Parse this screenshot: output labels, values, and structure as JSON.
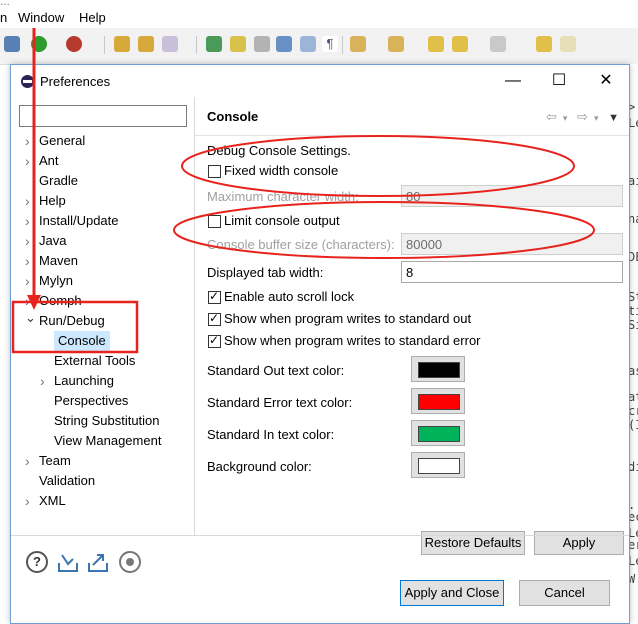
{
  "background_window": {
    "title_fragment": "...",
    "menu": [
      "n",
      "Window",
      "Help"
    ],
    "right_code_chars": [
      ">",
      "Le",
      "ai",
      "na",
      "DE",
      "St",
      "ti",
      "Si",
      "as",
      "at",
      "cr",
      "(I",
      "di",
      ".",
      "ec",
      "Le",
      "er",
      "Le",
      "W",
      "."
    ]
  },
  "dialog": {
    "title": "Preferences",
    "window_buttons": {
      "minimize": "—",
      "maximize": "☐",
      "close": "✕"
    },
    "filter_placeholder": "",
    "tree": [
      {
        "label": "General",
        "expandable": true
      },
      {
        "label": "Ant",
        "expandable": true
      },
      {
        "label": "Gradle",
        "expandable": false
      },
      {
        "label": "Help",
        "expandable": true
      },
      {
        "label": "Install/Update",
        "expandable": true
      },
      {
        "label": "Java",
        "expandable": true
      },
      {
        "label": "Maven",
        "expandable": true
      },
      {
        "label": "Mylyn",
        "expandable": true
      },
      {
        "label": "Oomph",
        "expandable": true
      },
      {
        "label": "Run/Debug",
        "expandable": true,
        "expanded": true
      },
      {
        "label": "Console",
        "child": true,
        "selected": true
      },
      {
        "label": "External Tools",
        "child": true
      },
      {
        "label": "Launching",
        "child": true,
        "expandable": true
      },
      {
        "label": "Perspectives",
        "child": true
      },
      {
        "label": "String Substitution",
        "child": true
      },
      {
        "label": "View Management",
        "child": true
      },
      {
        "label": "Team",
        "expandable": true
      },
      {
        "label": "Validation",
        "expandable": false
      },
      {
        "label": "XML",
        "expandable": true
      }
    ],
    "page": {
      "title": "Console",
      "section_label": "Debug Console Settings.",
      "fixed_width": {
        "label": "Fixed width console",
        "checked": false
      },
      "max_char_width": {
        "label": "Maximum character width:",
        "value": "80"
      },
      "limit_output": {
        "label": "Limit console output",
        "checked": false
      },
      "buffer_size": {
        "label": "Console buffer size (characters):",
        "value": "80000"
      },
      "tab_width": {
        "label": "Displayed tab width:",
        "value": "8"
      },
      "auto_scroll": {
        "label": "Enable auto scroll lock",
        "checked": true
      },
      "show_out": {
        "label": "Show when program writes to standard out",
        "checked": true
      },
      "show_err": {
        "label": "Show when program writes to standard error",
        "checked": true
      },
      "colors": [
        {
          "label": "Standard Out text color:",
          "color": "#000000"
        },
        {
          "label": "Standard Error text color:",
          "color": "#ff0000"
        },
        {
          "label": "Standard In text color:",
          "color": "#00b25a"
        },
        {
          "label": "Background color:",
          "color": "#ffffff"
        }
      ],
      "restore_defaults": "Restore Defaults",
      "apply": "Apply"
    },
    "apply_and_close": "Apply and Close",
    "cancel": "Cancel"
  },
  "annotation_color": "#e8231e"
}
